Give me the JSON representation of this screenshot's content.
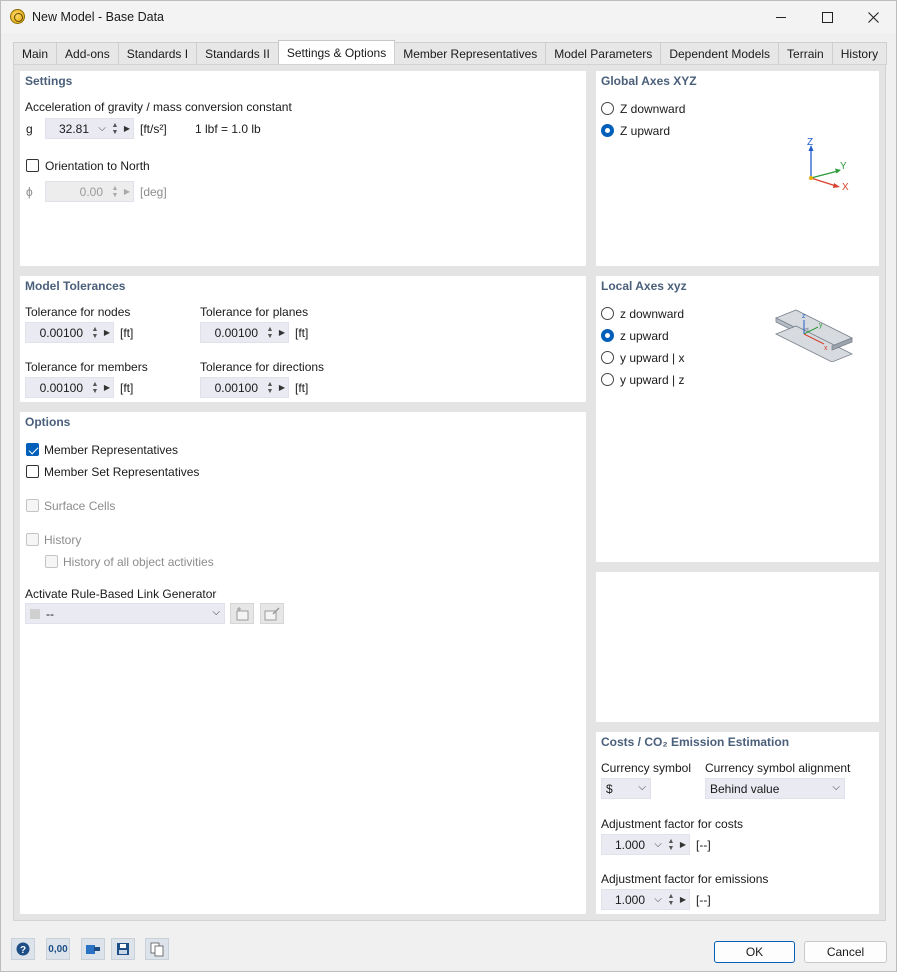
{
  "window": {
    "title": "New Model - Base Data"
  },
  "tabs": [
    {
      "label": "Main"
    },
    {
      "label": "Add-ons"
    },
    {
      "label": "Standards I"
    },
    {
      "label": "Standards II"
    },
    {
      "label": "Settings & Options",
      "active": true
    },
    {
      "label": "Member Representatives"
    },
    {
      "label": "Model Parameters"
    },
    {
      "label": "Dependent Models"
    },
    {
      "label": "Terrain"
    },
    {
      "label": "History"
    }
  ],
  "settings": {
    "title": "Settings",
    "gravity_label": "Acceleration of gravity / mass conversion constant",
    "g_symbol": "g",
    "g_value": "32.81",
    "g_unit": "[ft/s²]",
    "conversion": "1 lbf = 1.0 lb",
    "orientation_label": "Orientation to North",
    "orientation_checked": false,
    "phi_symbol": "ϕ",
    "phi_value": "0.00",
    "phi_unit": "[deg]"
  },
  "tolerances": {
    "title": "Model Tolerances",
    "nodes_label": "Tolerance for nodes",
    "nodes_value": "0.00100",
    "planes_label": "Tolerance for planes",
    "planes_value": "0.00100",
    "members_label": "Tolerance for members",
    "members_value": "0.00100",
    "directions_label": "Tolerance for directions",
    "directions_value": "0.00100",
    "unit": "[ft]"
  },
  "options": {
    "title": "Options",
    "member_rep": "Member Representatives",
    "member_rep_checked": true,
    "member_set_rep": "Member Set Representatives",
    "member_set_rep_checked": false,
    "surface_cells": "Surface Cells",
    "history": "History",
    "history_all": "History of all object activities",
    "rule_label": "Activate Rule-Based Link Generator",
    "rule_value": "--"
  },
  "global_axes": {
    "title": "Global Axes XYZ",
    "options": [
      "Z downward",
      "Z upward"
    ],
    "selected": "Z upward",
    "axis_z": "Z",
    "axis_y": "Y",
    "axis_x": "X"
  },
  "local_axes": {
    "title": "Local Axes xyz",
    "options": [
      "z downward",
      "z upward",
      "y upward | x",
      "y upward | z"
    ],
    "selected": "z upward",
    "axis_z": "z",
    "axis_y": "y",
    "axis_x": "x"
  },
  "costs": {
    "title": "Costs / CO₂ Emission Estimation",
    "currency_label": "Currency symbol",
    "currency_value": "$",
    "alignment_label": "Currency symbol alignment",
    "alignment_value": "Behind value",
    "cost_factor_label": "Adjustment factor for costs",
    "cost_factor_value": "1.000",
    "emission_factor_label": "Adjustment factor for emissions",
    "emission_factor_value": "1.000",
    "factor_unit": "[--]"
  },
  "toolbar": {
    "units_text": "0,00"
  },
  "buttons": {
    "ok": "OK",
    "cancel": "Cancel"
  },
  "colors": {
    "accent": "#005fb8",
    "panel_title": "#4a5f7a",
    "field_bg": "#e9eaf2"
  }
}
